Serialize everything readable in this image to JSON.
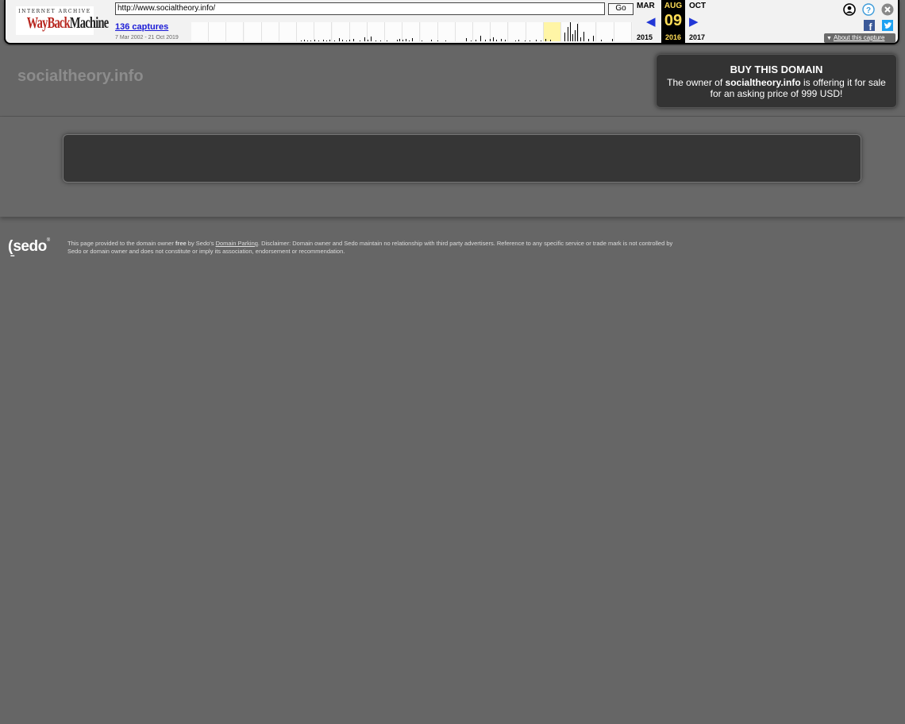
{
  "wayback": {
    "logo_top": "INTERNET ARCHIVE",
    "logo_way": "WayBack",
    "logo_machine": "Machine",
    "url": "http://www.socialtheory.info/",
    "go_label": "Go",
    "captures": "136 captures",
    "range": "7 Mar 2002 - 21 Oct 2019",
    "prev_month": "MAR",
    "cur_month": "AUG",
    "next_month": "OCT",
    "cur_day": "09",
    "prev_year": "2015",
    "cur_year": "2016",
    "next_year": "2017",
    "prev_arrow": "◀",
    "next_arrow": "▶",
    "about_label": "About this capture",
    "icons": [
      "user-icon",
      "help-icon",
      "close-icon",
      "facebook-icon",
      "twitter-icon"
    ],
    "accent_color": "#ffdd57"
  },
  "site": {
    "domain": "socialtheory.info",
    "buy_title": "BUY THIS DOMAIN",
    "buy_prefix": "The owner of ",
    "buy_domain": "socialtheory.info",
    "buy_suffix": " is offering it for sale for an asking price of 999 USD!"
  },
  "footer": {
    "logo": "sedo",
    "text1": "This page provided to the domain owner ",
    "text_bold": "free",
    "text2": " by Sedo's ",
    "link": "Domain Parking",
    "text3": ". Disclaimer: Domain owner and Sedo maintain no relationship with third party advertisers. Reference to any specific service or trade mark is not controlled by Sedo or domain owner and does not constitute or imply its association, endorsement or recommendation."
  }
}
